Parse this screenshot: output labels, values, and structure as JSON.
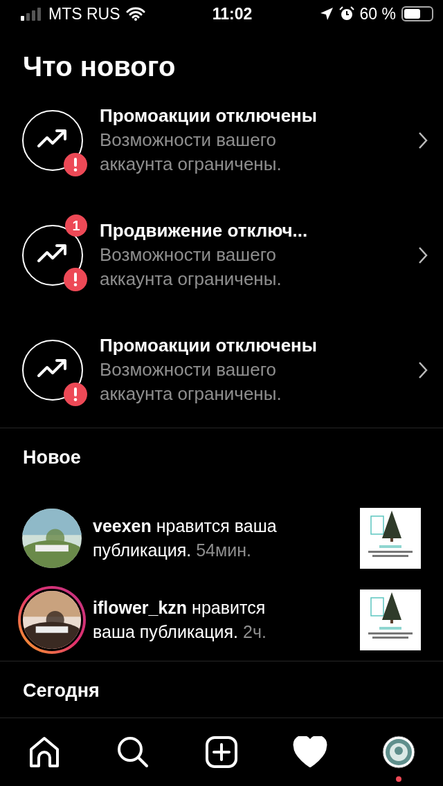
{
  "status_bar": {
    "carrier": "MTS RUS",
    "time": "11:02",
    "battery": "60 %"
  },
  "title": "Что нового",
  "promotions": [
    {
      "title": "Промоакции отключены",
      "subtitle": "Возможности вашего аккаунта ограничены."
    },
    {
      "title": "Продвижение отключ...",
      "subtitle": "Возможности вашего аккаунта ограничены.",
      "count": "1"
    },
    {
      "title": "Промоакции отключены",
      "subtitle": "Возможности вашего аккаунта ограничены."
    }
  ],
  "sections": [
    {
      "heading": "Новое",
      "notifications": [
        {
          "username": "veexen",
          "text": "нравится ваша публикация.",
          "time": "54мин.",
          "story_ring": false
        },
        {
          "username": "iflower_kzn",
          "text": "нравится ваша публикация.",
          "time": "2ч.",
          "story_ring": true
        }
      ]
    },
    {
      "heading": "Сегодня"
    }
  ],
  "tab_bar": [
    {
      "kind": "home",
      "selected": false
    },
    {
      "kind": "search",
      "selected": false
    },
    {
      "kind": "add",
      "selected": false
    },
    {
      "kind": "activity",
      "selected": true
    },
    {
      "kind": "profile",
      "selected": false,
      "dot": true
    }
  ]
}
